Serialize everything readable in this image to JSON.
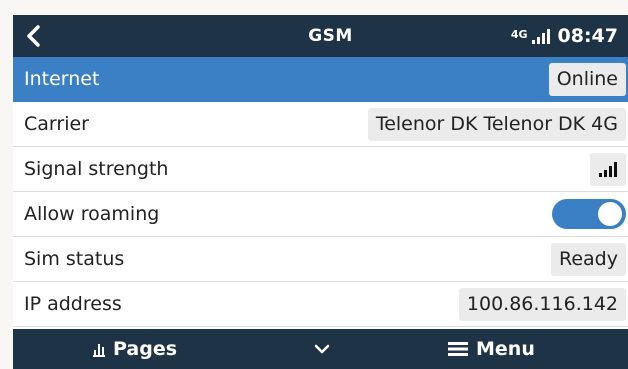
{
  "header": {
    "title": "GSM",
    "network_type": "4G",
    "time": "08:47",
    "signal_level": 4,
    "back_icon": "back-chevron-icon"
  },
  "rows": [
    {
      "label": "Internet",
      "value": "Online",
      "selected": true
    },
    {
      "label": "Carrier",
      "value": "Telenor DK Telenor DK 4G"
    },
    {
      "label": "Signal strength",
      "value_icon": "signal-strength-icon",
      "signal_level": 4
    },
    {
      "label": "Allow roaming",
      "toggle": true
    },
    {
      "label": "Sim status",
      "value": "Ready"
    },
    {
      "label": "IP address",
      "value": "100.86.116.142"
    }
  ],
  "footer": {
    "pages_label": "Pages",
    "menu_label": "Menu"
  },
  "colors": {
    "header_bg": "#1f3347",
    "accent": "#3b7fc4",
    "value_bg": "#ebebeb"
  }
}
